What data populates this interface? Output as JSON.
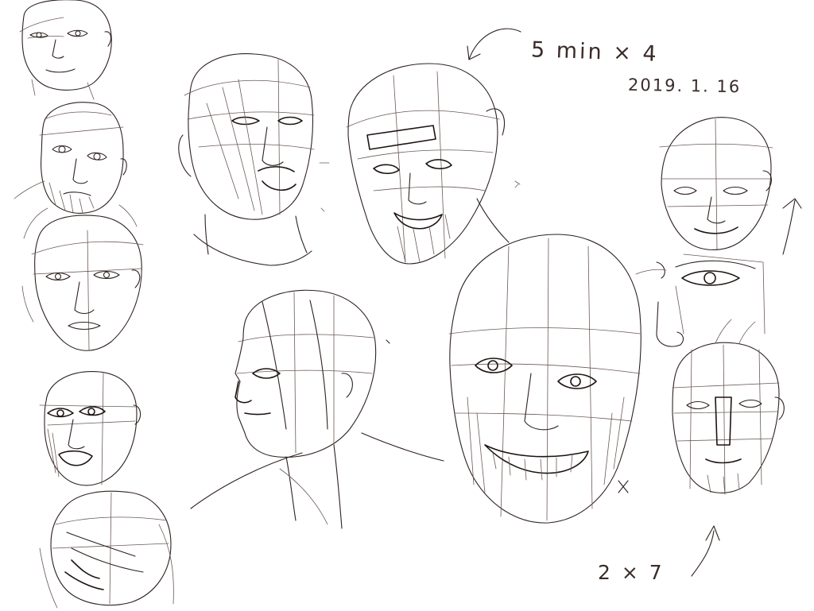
{
  "notes": {
    "duration": "5 min × 4",
    "date": "2019. 1. 16",
    "repeat": "2 × 7"
  },
  "colors": {
    "paper": "#ffffff",
    "ink": "#2e2220"
  }
}
